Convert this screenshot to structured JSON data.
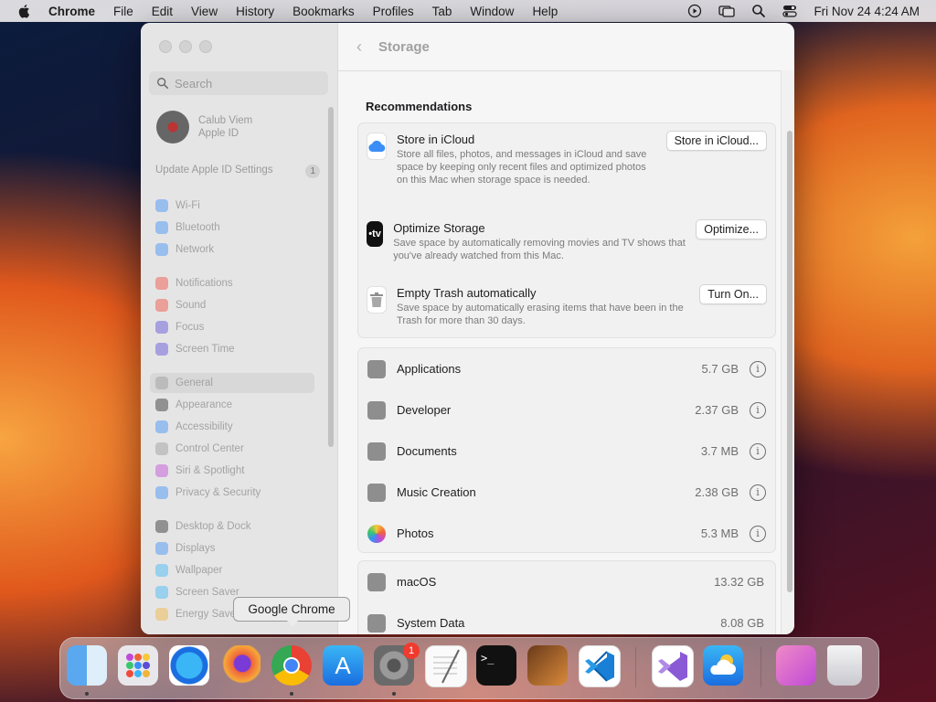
{
  "menubar": {
    "app": "Chrome",
    "menus": [
      "File",
      "Edit",
      "View",
      "History",
      "Bookmarks",
      "Profiles",
      "Tab",
      "Window",
      "Help"
    ],
    "datetime": "Fri Nov 24  4:24 AM"
  },
  "sidebar": {
    "search_placeholder": "Search",
    "account_name": "Calub Viem",
    "account_sub": "Apple ID",
    "update_label": "Update Apple ID Settings",
    "update_badge": "1",
    "items": [
      {
        "label": "Wi-Fi",
        "color": "#3a8ef6"
      },
      {
        "label": "Bluetooth",
        "color": "#3a8ef6"
      },
      {
        "label": "Network",
        "color": "#3a8ef6"
      },
      {
        "label": "Notifications",
        "color": "#f04a3a"
      },
      {
        "label": "Sound",
        "color": "#f04a3a"
      },
      {
        "label": "Focus",
        "color": "#5b4bd6"
      },
      {
        "label": "Screen Time",
        "color": "#5b4bd6"
      },
      {
        "label": "General",
        "color": "#9a9a9a"
      },
      {
        "label": "Appearance",
        "color": "#2b2b2b"
      },
      {
        "label": "Accessibility",
        "color": "#3a8ef6"
      },
      {
        "label": "Control Center",
        "color": "#9a9a9a"
      },
      {
        "label": "Siri & Spotlight",
        "color": "#c04ad6"
      },
      {
        "label": "Privacy & Security",
        "color": "#3a8ef6"
      },
      {
        "label": "Desktop & Dock",
        "color": "#2b2b2b"
      },
      {
        "label": "Displays",
        "color": "#3a8ef6"
      },
      {
        "label": "Wallpaper",
        "color": "#3ab6f6"
      },
      {
        "label": "Screen Saver",
        "color": "#3ab6f6"
      },
      {
        "label": "Energy Saver",
        "color": "#f0b43a"
      }
    ]
  },
  "content": {
    "title": "Storage",
    "recommendations_heading": "Recommendations",
    "recommendations": [
      {
        "title": "Store in iCloud",
        "desc": "Store all files, photos, and messages in iCloud and save space by keeping only recent files and optimized photos on this Mac when storage space is needed.",
        "button": "Store in iCloud...",
        "icon": "icloud-icon"
      },
      {
        "title": "Optimize Storage",
        "desc": "Save space by automatically removing movies and TV shows that you've already watched from this Mac.",
        "button": "Optimize...",
        "icon": "apple-tv-icon"
      },
      {
        "title": "Empty Trash automatically",
        "desc": "Save space by automatically erasing items that have been in the Trash for more than 30 days.",
        "button": "Turn On...",
        "icon": "trash-icon"
      }
    ],
    "categories": [
      {
        "label": "Applications",
        "size": "5.7 GB"
      },
      {
        "label": "Developer",
        "size": "2.37 GB"
      },
      {
        "label": "Documents",
        "size": "3.7 MB"
      },
      {
        "label": "Music Creation",
        "size": "2.38 GB"
      },
      {
        "label": "Photos",
        "size": "5.3 MB"
      }
    ],
    "system": [
      {
        "label": "macOS",
        "size": "13.32 GB"
      },
      {
        "label": "System Data",
        "size": "8.08 GB"
      }
    ],
    "info_glyph": "i"
  },
  "dock": {
    "tooltip": "Google Chrome",
    "settings_badge": "1",
    "apps": [
      "Finder",
      "Launchpad",
      "Safari",
      "Firefox",
      "Google Chrome",
      "App Store",
      "System Settings",
      "TextEdit",
      "Terminal",
      "GarageBand",
      "Visual Studio Code",
      "Visual Studio",
      "Weather",
      "Downloads",
      "Trash"
    ]
  }
}
